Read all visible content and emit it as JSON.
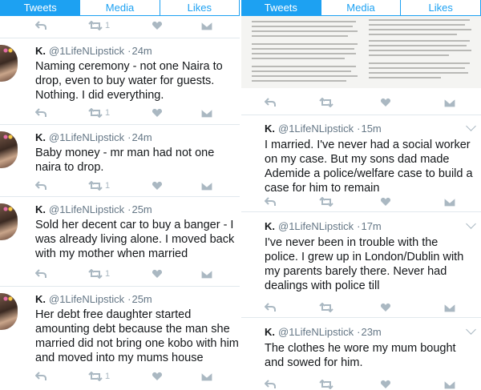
{
  "tabs": [
    "Tweets",
    "Media",
    "Likes"
  ],
  "author": {
    "name": "K.",
    "handle": "@1LifeNLipstick"
  },
  "left_tweets": [
    {
      "time": "",
      "text": "",
      "retweets": "1"
    },
    {
      "time": "24m",
      "text": "Naming ceremony - not one Naira to drop, even to buy water for guests. Nothing. I did everything.",
      "retweets": "1"
    },
    {
      "time": "24m",
      "text": "Baby money - mr man had not one naira to drop.",
      "retweets": "1"
    },
    {
      "time": "25m",
      "text": "Sold her decent car to buy a banger - I was already living alone. I moved back with my mother when married",
      "retweets": "1"
    },
    {
      "time": "25m",
      "text": "Her debt free daughter started amounting debt because the man she married did not bring one kobo with him and moved into my mums house",
      "retweets": "1"
    }
  ],
  "right_tweets": [
    {
      "time": "15m",
      "text": "I married. I've never had a social worker on my case. But my sons dad made Ademide a police/welfare case to build a case for him to remain"
    },
    {
      "time": "17m",
      "text": "I've never been in trouble with the police. I grew up in London/Dublin with my parents barely there. Never had dealings with police till"
    },
    {
      "time": "23m",
      "text": "The clothes he wore my mum bought and sowed for him."
    }
  ],
  "icons": {
    "reply": "reply-icon",
    "retweet": "retweet-icon",
    "like": "heart-icon",
    "message": "envelope-icon",
    "more": "chevron-down-icon"
  },
  "colors": {
    "accent": "#1da1f2",
    "muted": "#aab8c2",
    "text": "#14171a",
    "divider": "#e1e8ed"
  }
}
